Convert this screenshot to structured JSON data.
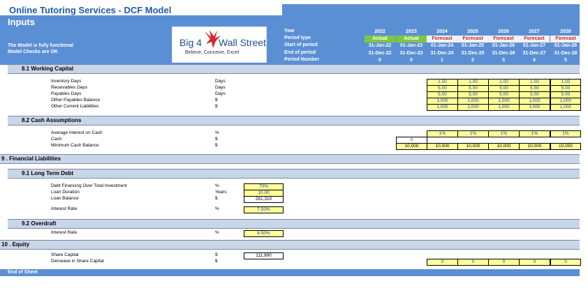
{
  "header": {
    "title": "Online Tutoring Services - DCF Model",
    "section_title": "Inputs",
    "status_functional": "The Model is fully functional",
    "status_checks": "Model Checks are OK"
  },
  "logo": {
    "left": "Big 4",
    "right": "Wall Street",
    "tagline": "Believe, Conceive, Excel",
    "accent_color": "#d7262b"
  },
  "timeline": {
    "labels": {
      "year": "Year",
      "period_type": "Period type",
      "start": "Start of period",
      "end": "End of period",
      "period_number": "Period Number"
    },
    "columns": [
      {
        "year": "2022",
        "type": "Actual",
        "start": "31-Jan-22",
        "end": "31-Dec-22",
        "num": "0"
      },
      {
        "year": "2023",
        "type": "Actual",
        "start": "01-Jan-23",
        "end": "31-Dec-23",
        "num": "0"
      },
      {
        "year": "2024",
        "type": "Forecast",
        "start": "01-Jan-24",
        "end": "31-Dec-24",
        "num": "1"
      },
      {
        "year": "2025",
        "type": "Forecast",
        "start": "01-Jan-25",
        "end": "31-Dec-25",
        "num": "2"
      },
      {
        "year": "2026",
        "type": "Forecast",
        "start": "01-Jan-26",
        "end": "31-Dec-26",
        "num": "3"
      },
      {
        "year": "2027",
        "type": "Forecast",
        "start": "01-Jan-27",
        "end": "31-Dec-27",
        "num": "4"
      },
      {
        "year": "2028",
        "type": "Forecast",
        "start": "01-Jan-28",
        "end": "31-Dec-28",
        "num": "5"
      }
    ],
    "colors": {
      "actual": "#7dc642",
      "forecast_text": "#c0262d",
      "header_blue": "#5b8fd4"
    }
  },
  "sections": {
    "s81": "8.1  Working Capital",
    "s82": "8.2  Cash Assumptions",
    "s9": "9 . Financial Liabilities",
    "s91": "9.1  Long Term Debt",
    "s92": "9.2  Overdraft",
    "s10": "10 . Equity"
  },
  "working_capital": [
    {
      "label": "Inventory Days",
      "unit": "Days",
      "values": [
        "1.00",
        "1.00",
        "1.00",
        "1.00",
        "1.00"
      ]
    },
    {
      "label": "Receivables Days",
      "unit": "Days",
      "values": [
        "5.00",
        "5.00",
        "5.00",
        "5.00",
        "5.00"
      ]
    },
    {
      "label": "Payables Days",
      "unit": "Days",
      "values": [
        "5.00",
        "5.00",
        "5.00",
        "5.00",
        "5.00"
      ]
    },
    {
      "label": "Other Payables Balance",
      "unit": "$",
      "values": [
        "1,000",
        "1,000",
        "1,000",
        "1,000",
        "1,000"
      ]
    },
    {
      "label": "Other Current Liabilities",
      "unit": "$",
      "values": [
        "1,000",
        "1,000",
        "1,000",
        "1,000",
        "1,000"
      ]
    }
  ],
  "cash": {
    "interest": {
      "label": "Average Interest on Cash",
      "unit": "%",
      "values": [
        "1%",
        "1%",
        "1%",
        "1%",
        "1%"
      ]
    },
    "cash": {
      "label": "Cash",
      "unit": "$",
      "value": "0"
    },
    "minimum": {
      "label": "Minimum Cash Balance",
      "unit": "$",
      "values": [
        "10,000",
        "10,000",
        "10,000",
        "10,000",
        "10,000",
        "10,000"
      ]
    }
  },
  "debt": {
    "financing": {
      "label": "Debt Financing Over Total Investment",
      "unit": "%",
      "value": "70%"
    },
    "duration": {
      "label": "Loan Duration",
      "unit": "Years",
      "value": "10.00"
    },
    "balance": {
      "label": "Loan Balance",
      "unit": "$",
      "value": "261,310"
    },
    "rate": {
      "label": "Interest Rate",
      "unit": "%",
      "value": "7.50%"
    }
  },
  "overdraft": {
    "rate": {
      "label": "Interest Rate",
      "unit": "%",
      "value": "8.50%"
    }
  },
  "equity": {
    "share_capital": {
      "label": "Share Capital",
      "unit": "$",
      "value": "111,990"
    },
    "decrease": {
      "label": "Decrease in Share Capital",
      "unit": "$",
      "values": [
        "0",
        "0",
        "0",
        "0",
        "0"
      ]
    }
  },
  "footer": {
    "end": "End of Sheet"
  }
}
